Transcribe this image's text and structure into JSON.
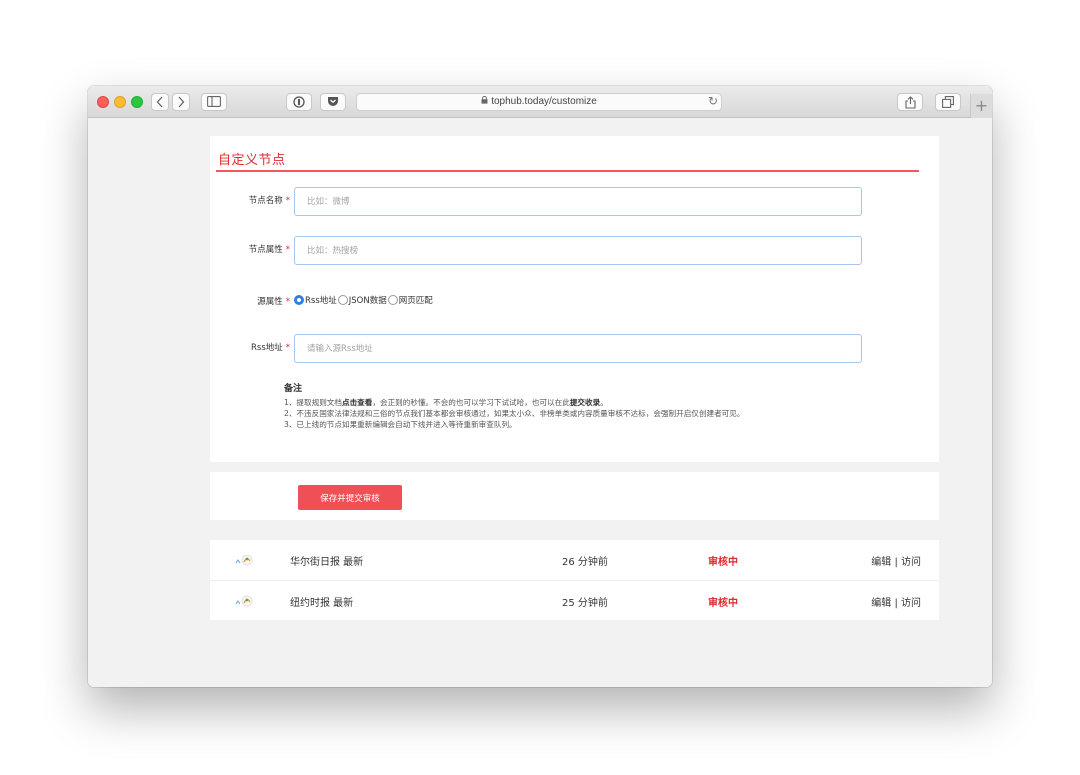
{
  "browser": {
    "url": "tophub.today/customize"
  },
  "form": {
    "title": "自定义节点",
    "node_name": {
      "label": "节点名称",
      "required": "*",
      "placeholder": "比如：微博"
    },
    "node_attr": {
      "label": "节点属性",
      "required": "*",
      "placeholder": "比如：热搜榜"
    },
    "source_attr": {
      "label": "源属性",
      "required": "*",
      "options": [
        "Rss地址",
        "JSON数据",
        "网页匹配"
      ],
      "selected": "Rss地址"
    },
    "rss_url": {
      "label": "Rss地址",
      "required": "*",
      "placeholder": "请输入源Rss地址"
    },
    "notes": {
      "heading": "备注",
      "line1_a": "1、提取规则文档",
      "line1_b": "点击查看",
      "line1_c": "，会正则的秒懂。不会的也可以学习下试试哈，也可以在此",
      "line1_d": "提交收录",
      "line1_e": "。",
      "line2": "2、不违反国家法律法规和三俗的节点我们基本都会审核通过，如果太小众、非榜单类或内容质量审核不达标，会强制开启仅创建者可见。",
      "line3": "3、已上线的节点如果重新编辑会自动下线并进入等待重新审查队列。"
    }
  },
  "save_button": "保存并提交审核",
  "submissions": [
    {
      "name": "华尔街日报 最新",
      "time": "26 分钟前",
      "status": "审核中",
      "edit": "编辑",
      "sep": "|",
      "visit": "访问"
    },
    {
      "name": "纽约时报 最新",
      "time": "25 分钟前",
      "status": "审核中",
      "edit": "编辑",
      "sep": "|",
      "visit": "访问"
    }
  ],
  "colors": {
    "accent": "#e0292f",
    "button": "#ef5055",
    "radio_selected": "#2f7ee8"
  }
}
